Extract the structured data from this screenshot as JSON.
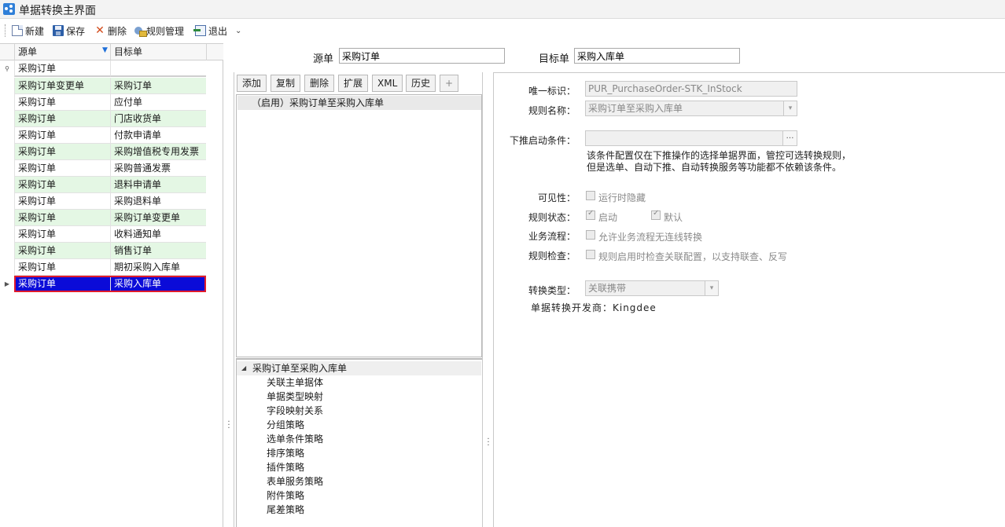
{
  "window": {
    "title": "单据转换主界面"
  },
  "toolbar": {
    "new_label": "新建",
    "save_label": "保存",
    "delete_label": "删除",
    "rules_label": "规则管理",
    "exit_label": "退出"
  },
  "grid": {
    "columns": [
      "源单",
      "目标单"
    ],
    "filter_row": {
      "source": "采购订单",
      "target": ""
    },
    "rows": [
      {
        "source": "采购订单变更单",
        "target": "采购订单"
      },
      {
        "source": "采购订单",
        "target": "应付单"
      },
      {
        "source": "采购订单",
        "target": "门店收货单"
      },
      {
        "source": "采购订单",
        "target": "付款申请单"
      },
      {
        "source": "采购订单",
        "target": "采购增值税专用发票"
      },
      {
        "source": "采购订单",
        "target": "采购普通发票"
      },
      {
        "source": "采购订单",
        "target": "退料申请单"
      },
      {
        "source": "采购订单",
        "target": "采购退料单"
      },
      {
        "source": "采购订单",
        "target": "采购订单变更单"
      },
      {
        "source": "采购订单",
        "target": "收料通知单"
      },
      {
        "source": "采购订单",
        "target": "销售订单"
      },
      {
        "source": "采购订单",
        "target": "期初采购入库单"
      },
      {
        "source": "采购订单",
        "target": "采购入库单"
      }
    ],
    "selected_index": 12
  },
  "header": {
    "source_label": "源单",
    "source_value": "采购订单",
    "target_label": "目标单",
    "target_value": "采购入库单"
  },
  "rule_buttons": {
    "add": "添加",
    "copy": "复制",
    "delete": "删除",
    "extend": "扩展",
    "xml": "XML",
    "history": "历史",
    "plus": "+"
  },
  "rule_list": {
    "items": [
      "（启用）采购订单至采购入库单"
    ]
  },
  "tree": {
    "root": "采购订单至采购入库单",
    "children": [
      "关联主单据体",
      "单据类型映射",
      "字段映射关系",
      "分组策略",
      "选单条件策略",
      "排序策略",
      "插件策略",
      "表单服务策略",
      "附件策略",
      "尾差策略"
    ]
  },
  "form": {
    "unique_id_label": "唯一标识：",
    "unique_id_value": "PUR_PurchaseOrder-STK_InStock",
    "rule_name_label": "规则名称：",
    "rule_name_value": "采购订单至采购入库单",
    "push_condition_label": "下推启动条件：",
    "push_condition_value": "",
    "push_condition_note_1": "该条件配置仅在下推操作的选择单据界面，管控可选转换规则，",
    "push_condition_note_2": "但是选单、自动下推、自动转换服务等功能都不依赖该条件。",
    "visibility_label": "可见性：",
    "visibility_option": "运行时隐藏",
    "rule_status_label": "规则状态：",
    "status_enabled": "启动",
    "status_default": "默认",
    "workflow_label": "业务流程：",
    "workflow_option": "允许业务流程无连线转换",
    "rule_check_label": "规则检查：",
    "rule_check_option": "规则启用时检查关联配置，以支持联查、反写",
    "convert_type_label": "转换类型：",
    "convert_type_value": "关联携带",
    "developer_text": "单据转换开发商：Kingdee"
  },
  "colors": {
    "selected_row_bg": "#0b0bd8",
    "selected_row_outline": "#e01b2c",
    "alt_row_bg": "#e4f7e4",
    "app_icon": "#2f7fd8"
  }
}
